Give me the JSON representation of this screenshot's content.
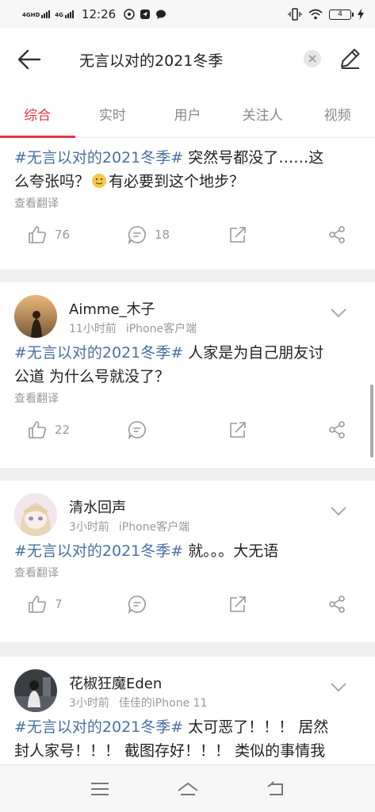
{
  "status_bar": {
    "signal1": "4GHD",
    "signal2": "4G",
    "time": "12:26",
    "battery": "4"
  },
  "header": {
    "query": "无言以对的2021冬季"
  },
  "tabs": [
    {
      "label": "综合",
      "active": true
    },
    {
      "label": "实时"
    },
    {
      "label": "用户"
    },
    {
      "label": "关注人"
    },
    {
      "label": "视频"
    }
  ],
  "posts": [
    {
      "hashtag": "#无言以对的2021冬季#",
      "text_line1": " 突然号都没了……这",
      "text_line2a": "么夸张吗？",
      "text_line2b": "有必要到这个地步？",
      "translate": "查看翻译",
      "likes": "76",
      "comments": "18"
    },
    {
      "username": "Aimme_木子",
      "time": "11小时前",
      "source": "iPhone客户端",
      "hashtag": "#无言以对的2021冬季#",
      "text_line1": " 人家是为自己朋友讨",
      "text_line2": "公道 为什么号就没了？",
      "translate": "查看翻译",
      "likes": "22"
    },
    {
      "username": "清水回声",
      "time": "3小时前",
      "source": "iPhone客户端",
      "hashtag": "#无言以对的2021冬季#",
      "text_line1": " 就。。。大无语",
      "translate": "查看翻译",
      "likes": "7"
    },
    {
      "username": "花椒狂魔Eden",
      "time": "3小时前",
      "source": "佳佳的iPhone 11",
      "hashtag": "#无言以对的2021冬季#",
      "text_line1": " 太可恶了！！！ 居然",
      "text_line2": "封人家号！！！ 截图存好！！！ 类似的事情我"
    }
  ],
  "colors": {
    "accent": "#e4393c",
    "hashtag": "#4a6fa5",
    "muted": "#999999"
  }
}
